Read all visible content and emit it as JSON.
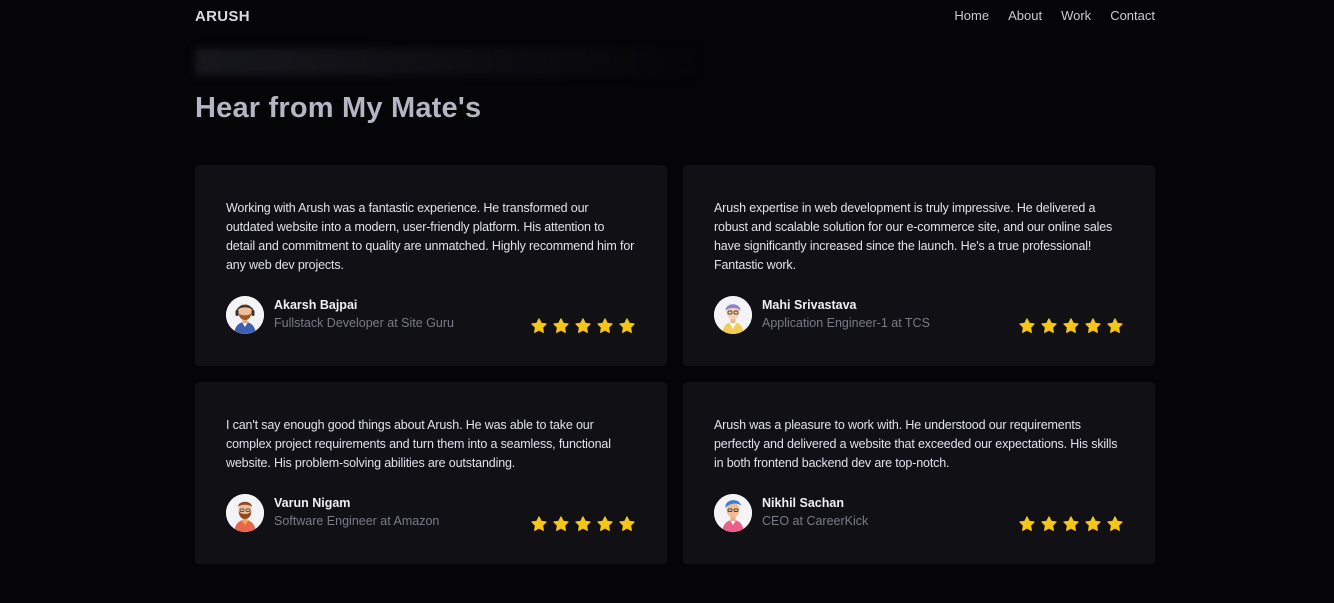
{
  "nav": {
    "brand": "ARUSH",
    "links": [
      "Home",
      "About",
      "Work",
      "Contact"
    ]
  },
  "section": {
    "title": "Hear from My Mate's"
  },
  "testimonials": [
    {
      "quote": "Working with Arush was a fantastic experience. He transformed our outdated website into a modern, user-friendly platform. His attention to detail and commitment to quality are unmatched. Highly recommend him for any web dev projects.",
      "name": "Akarsh Bajpai",
      "role": "Fullstack Developer at Site Guru",
      "rating": 5,
      "avatar_icon": "avatar-headset-icon"
    },
    {
      "quote": "Arush expertise in web development is truly impressive. He delivered a robust and scalable solution for our e-commerce site, and our online sales have significantly increased since the launch. He's a true professional! Fantastic work.",
      "name": "Mahi Srivastava",
      "role": "Application Engineer-1 at TCS",
      "rating": 5,
      "avatar_icon": "avatar-purple-hair-icon"
    },
    {
      "quote": "I can't say enough good things about Arush. He was able to take our complex project requirements and turn them into a seamless, functional website. His problem-solving abilities are outstanding.",
      "name": "Varun Nigam",
      "role": "Software Engineer at Amazon",
      "rating": 5,
      "avatar_icon": "avatar-bearded-icon"
    },
    {
      "quote": "Arush was a pleasure to work with. He understood our requirements perfectly and delivered a website that exceeded our expectations. His skills in both frontend backend dev are top-notch.",
      "name": "Nikhil Sachan",
      "role": "CEO at CareerKick",
      "rating": 5,
      "avatar_icon": "avatar-blue-hair-icon"
    }
  ],
  "colors": {
    "background": "#050507",
    "card": "#101015",
    "star": "#f5c518",
    "title": "#b4b6c3",
    "muted": "#7a7b86"
  }
}
